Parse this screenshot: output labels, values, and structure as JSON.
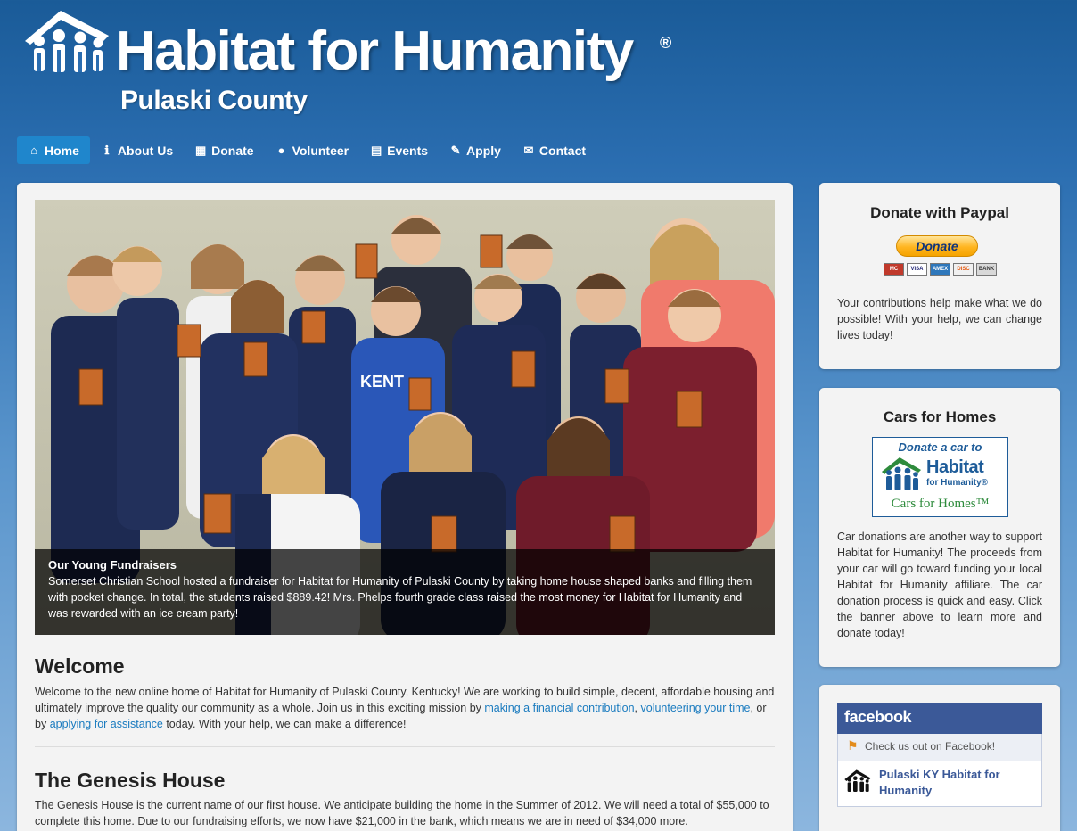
{
  "header": {
    "brand": "Habitat for Humanity",
    "reg": "®",
    "subtitle": "Pulaski County"
  },
  "nav": [
    {
      "label": "Home",
      "icon": "home-icon",
      "glyph": "⌂",
      "active": true
    },
    {
      "label": "About Us",
      "icon": "info-icon",
      "glyph": "ℹ",
      "active": false
    },
    {
      "label": "Donate",
      "icon": "gift-icon",
      "glyph": "▦",
      "active": false
    },
    {
      "label": "Volunteer",
      "icon": "user-icon",
      "glyph": "●",
      "active": false
    },
    {
      "label": "Events",
      "icon": "calendar-icon",
      "glyph": "▤",
      "active": false
    },
    {
      "label": "Apply",
      "icon": "pencil-icon",
      "glyph": "✎",
      "active": false
    },
    {
      "label": "Contact",
      "icon": "envelope-icon",
      "glyph": "✉",
      "active": false
    }
  ],
  "hero": {
    "caption_title": "Our Young Fundraisers",
    "caption_text": "Somerset Christian School hosted a fundraiser for Habitat for Humanity of Pulaski County by taking home house shaped banks and filling them with pocket change. In total, the students raised $889.42! Mrs. Phelps fourth grade class raised the most money for Habitat for Humanity and was rewarded with an ice cream party!"
  },
  "welcome": {
    "title": "Welcome",
    "text_1": "Welcome to the new online home of Habitat for Humanity of Pulaski County, Kentucky! We are working to build simple, decent, affordable housing and ultimately improve the quality our community as a whole. Join us in this exciting mission by ",
    "link_1": "making a financial contribution",
    "text_2": ", ",
    "link_2": "volunteering your time",
    "text_3": ", or by ",
    "link_3": "applying for assistance",
    "text_4": " today. With your help, we can make a difference!"
  },
  "genesis": {
    "title": "The Genesis House",
    "text": "The Genesis House is the current name of our first house. We anticipate building the home in the Summer of 2012. We will need a total of $55,000 to complete this home. Due to our fundraising efforts, we now have $21,000 in the bank, which means we are in need of $34,000 more."
  },
  "paypal": {
    "title": "Donate with Paypal",
    "button": "Donate",
    "cards": [
      "MC",
      "VISA",
      "AMEX",
      "DISC",
      "BANK"
    ],
    "text": "Your contributions help make what we do possible! With your help, we can change lives today!"
  },
  "cars": {
    "title": "Cars for Homes",
    "banner_top": "Donate a car to",
    "banner_brand": "Habitat",
    "banner_brand2": "for Humanity®",
    "banner_foot": "Cars for Homes™",
    "text": "Car donations are another way to support Habitat for Humanity! The proceeds from your car will go toward funding your local Habitat for Humanity affiliate. The car donation process is quick and easy. Click the banner above to learn more and donate today!"
  },
  "facebook": {
    "brand": "facebook",
    "bar_text": "Check us out on Facebook!",
    "page_name": "Pulaski KY Habitat for Humanity"
  },
  "colors": {
    "nav_active": "#1f86cc",
    "link": "#1a7bbf",
    "facebook": "#3b5998"
  }
}
